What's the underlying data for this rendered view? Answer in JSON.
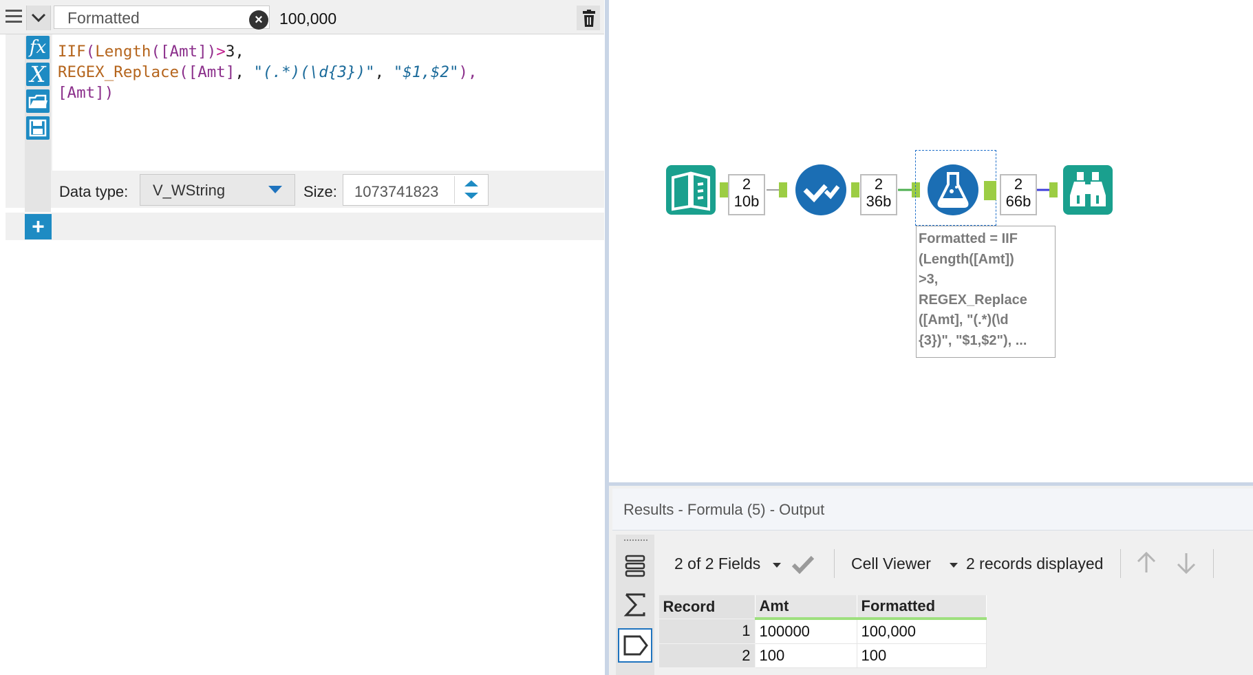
{
  "formula_editor": {
    "field_name": "Formatted",
    "preview_value": "100,000",
    "expression_lines": [
      [
        "IIF",
        "(",
        "Length",
        "(",
        "[Amt]",
        ")",
        ">",
        "3",
        ","
      ],
      [
        "REGEX_Replace",
        "(",
        "[Amt]",
        ", ",
        "\"(.*)(\\d{3})\"",
        ", ",
        "\"$1,$2\"",
        "),"
      ],
      [
        "[Amt]",
        ")"
      ]
    ],
    "data_type_label": "Data type:",
    "data_type_value": "V_WString",
    "size_label": "Size:",
    "size_value": "1073741823",
    "add_button_label": "+",
    "side_icons": [
      "fx-icon",
      "variable-x-icon",
      "open-folder-icon",
      "save-icon"
    ]
  },
  "workflow": {
    "tools": [
      {
        "name": "text-input-tool-icon",
        "color": "#1aa08e"
      },
      {
        "name": "select-tool-icon",
        "color": "#1b6eb4"
      },
      {
        "name": "formula-tool-icon",
        "color": "#1b6eb4"
      },
      {
        "name": "browse-tool-icon",
        "color": "#1aa08e"
      }
    ],
    "connections": [
      {
        "records": "2",
        "size": "10b"
      },
      {
        "records": "2",
        "size": "36b"
      },
      {
        "records": "2",
        "size": "66b"
      }
    ],
    "annotation": "Formatted = IIF\n(Length([Amt])\n>3,\nREGEX_Replace\n([Amt], \"(.*)(\\d\n{3})\", \"$1,$2\"), ..."
  },
  "results": {
    "title": "Results - Formula (5) - Output",
    "fields_selector": "2 of 2 Fields",
    "viewer": "Cell Viewer",
    "records_displayed": "2 records displayed",
    "columns": [
      "Record",
      "Amt",
      "Formatted"
    ],
    "rows": [
      [
        "1",
        "100000",
        "100,000"
      ],
      [
        "2",
        "100",
        "100"
      ]
    ]
  }
}
